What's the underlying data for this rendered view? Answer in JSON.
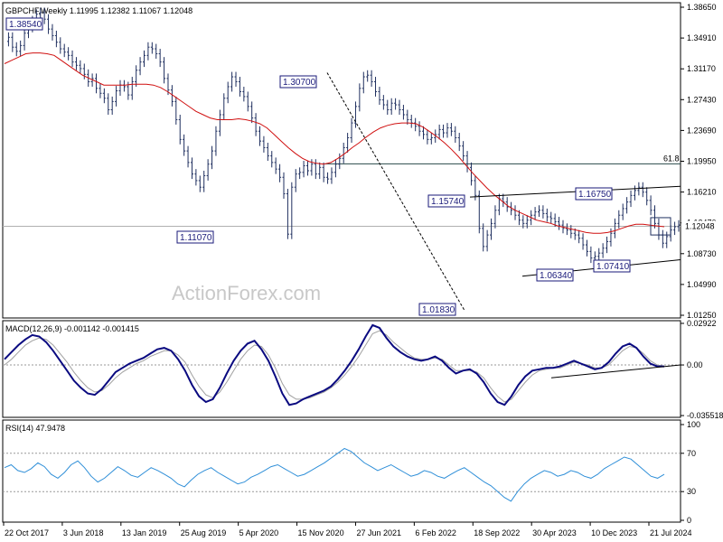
{
  "chart_data": [
    {
      "type": "candlestick",
      "title": "GBPCHF,Weekly",
      "ohlc_label": "1.11995 1.12382 1.11067 1.12048",
      "current_price": "1.12048",
      "y_ticks": [
        "1.38650",
        "1.34910",
        "1.31170",
        "1.27430",
        "1.23690",
        "1.19950",
        "1.16210",
        "1.12470",
        "1.08730",
        "1.04990",
        "1.01250"
      ],
      "ylim": [
        1.0125,
        1.3865
      ],
      "x_ticks": [
        "22 Oct 2017",
        "3 Jun 2018",
        "13 Jan 2019",
        "25 Aug 2019",
        "5 Apr 2020",
        "15 Nov 2020",
        "27 Jun 2021",
        "6 Feb 2022",
        "18 Sep 2022",
        "30 Apr 2023",
        "10 Dec 2023",
        "21 Jul 2024"
      ],
      "price_series": [
        1.345,
        1.35,
        1.338,
        1.333,
        1.34,
        1.355,
        1.362,
        1.37,
        1.378,
        1.38,
        1.372,
        1.36,
        1.352,
        1.344,
        1.336,
        1.332,
        1.328,
        1.32,
        1.316,
        1.312,
        1.305,
        1.296,
        1.3,
        1.288,
        1.282,
        1.276,
        1.262,
        1.272,
        1.285,
        1.292,
        1.29,
        1.28,
        1.296,
        1.31,
        1.32,
        1.328,
        1.338,
        1.336,
        1.33,
        1.32,
        1.3,
        1.286,
        1.272,
        1.25,
        1.226,
        1.212,
        1.198,
        1.184,
        1.176,
        1.168,
        1.182,
        1.196,
        1.212,
        1.236,
        1.256,
        1.276,
        1.29,
        1.302,
        1.296,
        1.284,
        1.278,
        1.266,
        1.252,
        1.236,
        1.224,
        1.216,
        1.206,
        1.198,
        1.19,
        1.18,
        1.16,
        1.111,
        1.168,
        1.184,
        1.186,
        1.194,
        1.188,
        1.196,
        1.184,
        1.192,
        1.18,
        1.178,
        1.186,
        1.196,
        1.203,
        1.216,
        1.228,
        1.246,
        1.266,
        1.288,
        1.302,
        1.304,
        1.296,
        1.284,
        1.274,
        1.268,
        1.262,
        1.27,
        1.268,
        1.262,
        1.256,
        1.25,
        1.246,
        1.242,
        1.236,
        1.232,
        1.226,
        1.228,
        1.232,
        1.238,
        1.234,
        1.24,
        1.236,
        1.228,
        1.218,
        1.206,
        1.192,
        1.176,
        1.158,
        1.118,
        1.096,
        1.11,
        1.124,
        1.14,
        1.154,
        1.15,
        1.144,
        1.14,
        1.134,
        1.128,
        1.124,
        1.128,
        1.134,
        1.138,
        1.14,
        1.136,
        1.132,
        1.13,
        1.126,
        1.122,
        1.118,
        1.116,
        1.112,
        1.11,
        1.106,
        1.098,
        1.09,
        1.082,
        1.084,
        1.088,
        1.094,
        1.102,
        1.112,
        1.124,
        1.134,
        1.142,
        1.15,
        1.158,
        1.164,
        1.168,
        1.162,
        1.152,
        1.14,
        1.124,
        1.11,
        1.1,
        1.108,
        1.116,
        1.12,
        1.122
      ],
      "ma_series": [
        1.318,
        1.322,
        1.326,
        1.33,
        1.331,
        1.331,
        1.33,
        1.328,
        1.322,
        1.316,
        1.31,
        1.304,
        1.3,
        1.296,
        1.292,
        1.292,
        1.292,
        1.292,
        1.293,
        1.293,
        1.293,
        1.292,
        1.289,
        1.284,
        1.278,
        1.272,
        1.266,
        1.26,
        1.256,
        1.252,
        1.25,
        1.25,
        1.25,
        1.251,
        1.25,
        1.248,
        1.245,
        1.24,
        1.232,
        1.224,
        1.216,
        1.209,
        1.203,
        1.199,
        1.197,
        1.196,
        1.198,
        1.203,
        1.209,
        1.216,
        1.222,
        1.229,
        1.235,
        1.24,
        1.243,
        1.245,
        1.246,
        1.246,
        1.245,
        1.241,
        1.235,
        1.229,
        1.222,
        1.214,
        1.205,
        1.195,
        1.185,
        1.176,
        1.167,
        1.159,
        1.152,
        1.145,
        1.14,
        1.136,
        1.132,
        1.128,
        1.126,
        1.124,
        1.121,
        1.119,
        1.117,
        1.115,
        1.113,
        1.112,
        1.112,
        1.113,
        1.115,
        1.118,
        1.121,
        1.123,
        1.123,
        1.122,
        1.121,
        1.12
      ],
      "fib": {
        "label": "61.8",
        "value": 1.1963
      },
      "price_labels": [
        {
          "label": "1.38540",
          "x": 0,
          "value": 1.3854
        },
        {
          "label": "1.30700",
          "x": 0,
          "value": 1.307
        },
        {
          "label": "1.11070",
          "x": 0,
          "value": 1.1107
        },
        {
          "label": "1.15740",
          "x": 0,
          "value": 1.1574
        },
        {
          "label": "1.16750",
          "x": 0,
          "value": 1.1675
        },
        {
          "label": "1.06340",
          "x": 0,
          "value": 1.0634
        },
        {
          "label": "1.07410",
          "x": 0,
          "value": 1.0741
        },
        {
          "label": "1.01830",
          "x": 0,
          "value": 1.0183
        }
      ],
      "watermark": "ActionForex.com"
    },
    {
      "type": "line",
      "title": "MACD(12,26,9) -0.001142 -0.001415",
      "y_ticks": [
        "0.02922",
        "0.00",
        "-0.035518"
      ],
      "ylim": [
        -0.0355,
        0.0292
      ],
      "macd": [
        0.004,
        0.009,
        0.014,
        0.018,
        0.021,
        0.02,
        0.016,
        0.01,
        0.003,
        -0.004,
        -0.011,
        -0.016,
        -0.02,
        -0.021,
        -0.017,
        -0.011,
        -0.005,
        -0.002,
        0.001,
        0.003,
        0.005,
        0.008,
        0.011,
        0.012,
        0.01,
        0.004,
        -0.004,
        -0.014,
        -0.022,
        -0.026,
        -0.024,
        -0.016,
        -0.006,
        0.003,
        0.01,
        0.015,
        0.017,
        0.011,
        0.003,
        -0.008,
        -0.02,
        -0.028,
        -0.027,
        -0.024,
        -0.022,
        -0.02,
        -0.018,
        -0.015,
        -0.01,
        -0.004,
        0.003,
        0.011,
        0.02,
        0.028,
        0.026,
        0.019,
        0.013,
        0.009,
        0.006,
        0.004,
        0.003,
        0.004,
        0.006,
        0.003,
        -0.002,
        -0.006,
        -0.004,
        -0.003,
        -0.006,
        -0.012,
        -0.02,
        -0.026,
        -0.028,
        -0.022,
        -0.014,
        -0.008,
        -0.004,
        -0.003,
        -0.002,
        -0.002,
        -0.001,
        0.001,
        0.003,
        0.001,
        -0.001,
        -0.003,
        -0.002,
        0.002,
        0.008,
        0.013,
        0.015,
        0.012,
        0.006,
        0.001,
        -0.001,
        -0.001
      ],
      "signal": [
        0.0,
        0.004,
        0.009,
        0.014,
        0.017,
        0.019,
        0.018,
        0.014,
        0.008,
        0.002,
        -0.005,
        -0.011,
        -0.016,
        -0.019,
        -0.018,
        -0.014,
        -0.009,
        -0.005,
        -0.002,
        0.001,
        0.003,
        0.006,
        0.008,
        0.01,
        0.01,
        0.007,
        0.002,
        -0.007,
        -0.015,
        -0.021,
        -0.023,
        -0.019,
        -0.012,
        -0.004,
        0.004,
        0.01,
        0.014,
        0.013,
        0.007,
        -0.002,
        -0.013,
        -0.021,
        -0.024,
        -0.024,
        -0.023,
        -0.021,
        -0.019,
        -0.016,
        -0.012,
        -0.007,
        -0.001,
        0.006,
        0.014,
        0.022,
        0.024,
        0.021,
        0.016,
        0.012,
        0.008,
        0.005,
        0.004,
        0.004,
        0.005,
        0.004,
        0.0,
        -0.004,
        -0.004,
        -0.004,
        -0.005,
        -0.009,
        -0.016,
        -0.022,
        -0.026,
        -0.024,
        -0.018,
        -0.012,
        -0.007,
        -0.004,
        -0.003,
        -0.002,
        -0.002,
        0.0,
        0.002,
        0.001,
        0.0,
        -0.002,
        -0.002,
        0.0,
        0.005,
        0.01,
        0.013,
        0.012,
        0.008,
        0.003,
        0.0,
        -0.001
      ]
    },
    {
      "type": "line",
      "title": "RSI(14) 47.9478",
      "y_ticks": [
        "100",
        "70",
        "30",
        "0"
      ],
      "ylim": [
        0,
        100
      ],
      "rsi": [
        55,
        58,
        52,
        50,
        54,
        60,
        56,
        48,
        44,
        50,
        58,
        62,
        55,
        46,
        40,
        44,
        50,
        56,
        52,
        47,
        45,
        50,
        55,
        52,
        48,
        44,
        38,
        35,
        42,
        48,
        52,
        55,
        50,
        46,
        42,
        38,
        40,
        45,
        48,
        52,
        56,
        58,
        54,
        50,
        46,
        48,
        52,
        56,
        60,
        65,
        70,
        75,
        72,
        66,
        60,
        56,
        52,
        55,
        58,
        54,
        50,
        46,
        48,
        52,
        50,
        46,
        44,
        48,
        52,
        55,
        50,
        45,
        40,
        36,
        30,
        24,
        20,
        30,
        38,
        44,
        48,
        52,
        50,
        46,
        48,
        52,
        50,
        46,
        44,
        48,
        54,
        58,
        62,
        66,
        64,
        58,
        52,
        46,
        44,
        48
      ]
    }
  ]
}
